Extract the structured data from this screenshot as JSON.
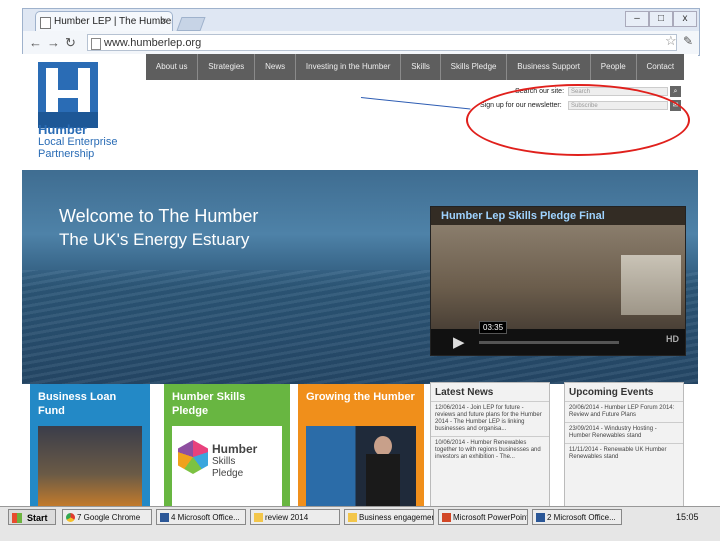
{
  "browser": {
    "tab_title": "Humber LEP | The Humber",
    "tab_close": "×",
    "url": "www.humberlep.org",
    "window_controls": [
      "–",
      "□",
      "x"
    ],
    "icons": [
      "back-arrow-icon",
      "forward-arrow-icon",
      "reload-icon",
      "bookmark-star-icon",
      "wrench-menu-icon"
    ]
  },
  "site": {
    "nav": [
      "About us",
      "Strategies",
      "News",
      "Investing in the Humber",
      "Skills",
      "Skills Pledge",
      "Business Support",
      "People",
      "Contact"
    ],
    "logo": {
      "line1": "Humber",
      "line2": "Local Enterprise Partnership"
    },
    "search": {
      "label": "Search our site:",
      "placeholder": "Search"
    },
    "newsletter": {
      "label": "Sign up for our newsletter:",
      "placeholder": "Subscribe"
    },
    "hero": {
      "title": "Welcome to The Humber",
      "subtitle": "The UK's Energy Estuary"
    },
    "video": {
      "title": "Humber Lep Skills Pledge Final",
      "time": "03:35",
      "hd": "HD"
    },
    "cards": [
      {
        "title": "Business Loan Fund",
        "color": "#2389c6"
      },
      {
        "title": "Humber Skills Pledge",
        "color": "#68b641",
        "logo_text": [
          "Humber",
          "Skills",
          "Pledge"
        ]
      },
      {
        "title": "Growing the Humber",
        "color": "#f08f1b"
      }
    ],
    "news": {
      "heading": "Latest News",
      "items": [
        "12/06/2014 - Join LEP for future - reviews and future plans for the Humber 2014 - The Humber LEP is linking businesses and organisa...",
        "10/06/2014 - Humber Renewables together to with regions businesses and investors an exhibition - The..."
      ]
    },
    "events": {
      "heading": "Upcoming Events",
      "items": [
        "20/06/2014 - Humber LEP Forum 2014: Review and Future Plans",
        "23/09/2014 - Windustry Hosting - Humber Renewables stand",
        "11/11/2014 - Renewable UK Humber Renewables stand"
      ]
    }
  },
  "taskbar": {
    "start": "Start",
    "buttons": [
      "7 Google Chrome",
      "4 Microsoft Office...",
      "review 2014",
      "Business engagement",
      "Microsoft PowerPoint...",
      "2 Microsoft Office..."
    ],
    "clock": "15:05"
  },
  "colors": {
    "brand_blue": "#2a6cb5",
    "annotation_red": "#e0201c",
    "annotation_blue": "#2d5cb3"
  }
}
